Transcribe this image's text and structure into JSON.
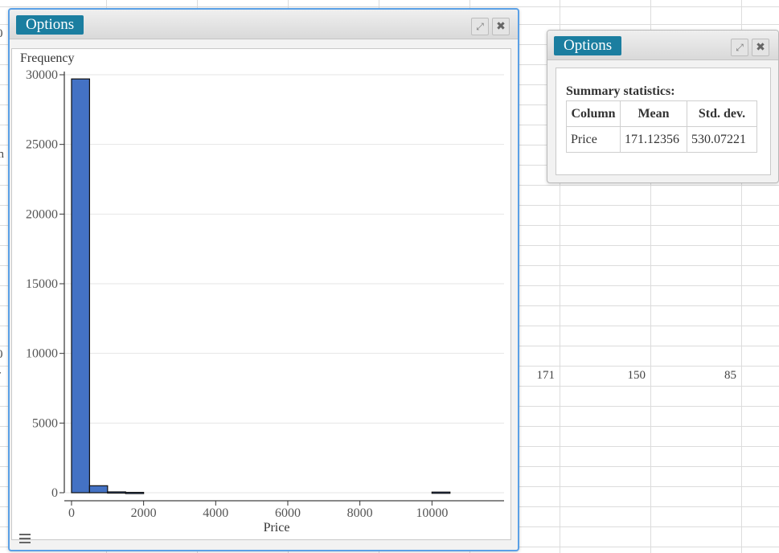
{
  "sheet": {
    "row_values": [
      "171",
      "150",
      "85"
    ],
    "left_fragments": [
      "0",
      "on",
      "0",
      "r"
    ]
  },
  "histogram_panel": {
    "options_label": "Options",
    "expand_icon": "expand-icon",
    "close_icon": "close-icon",
    "menu_icon": "hamburger-menu-icon"
  },
  "stats_panel": {
    "options_label": "Options",
    "expand_icon": "expand-icon",
    "close_icon": "close-icon",
    "title": "Summary statistics:",
    "headers": [
      "Column",
      "Mean",
      "Std. dev."
    ],
    "rows": [
      [
        "Price",
        "171.12356",
        "530.07221"
      ]
    ]
  },
  "chart_data": {
    "type": "bar",
    "title": "",
    "xlabel": "Price",
    "ylabel": "Frequency",
    "xlim": [
      -200,
      12000
    ],
    "ylim": [
      0,
      30000
    ],
    "xticks": [
      0,
      2000,
      4000,
      6000,
      8000,
      10000
    ],
    "yticks": [
      0,
      5000,
      10000,
      15000,
      20000,
      25000,
      30000
    ],
    "bin_width": 500,
    "bins": [
      {
        "start": 0,
        "end": 500,
        "count": 29700
      },
      {
        "start": 500,
        "end": 1000,
        "count": 500
      },
      {
        "start": 1000,
        "end": 1500,
        "count": 60
      },
      {
        "start": 1500,
        "end": 2000,
        "count": 25
      },
      {
        "start": 10000,
        "end": 10500,
        "count": 45
      }
    ],
    "bar_color": "#4472c4",
    "grid": true
  }
}
